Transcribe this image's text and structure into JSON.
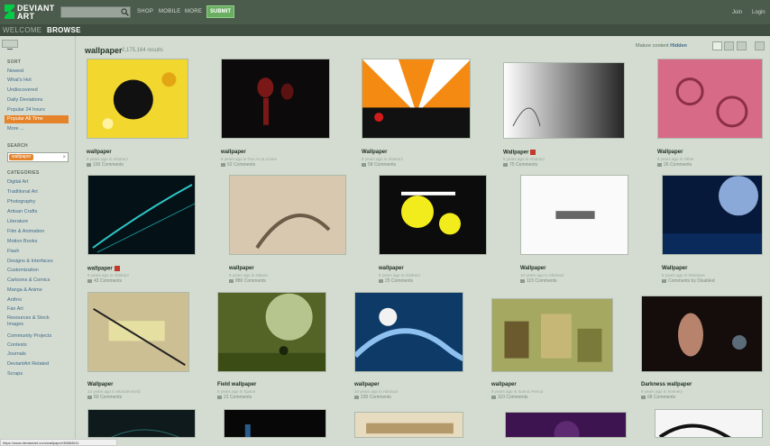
{
  "colors": {
    "topbar": "#4b5b4c",
    "accent": "#e4832a",
    "submit": "#6aae62",
    "link": "#3f6a8a"
  },
  "header": {
    "logo_line1": "DEVIANT",
    "logo_line2": "ART",
    "search_placeholder": "",
    "nav": [
      "SHOP",
      "MOBILE",
      "MORE"
    ],
    "submit": "SUBMIT",
    "join": "Join",
    "login": "Login",
    "tab_welcome": "WELCOME",
    "tab_browse": "BROWSE"
  },
  "sidebar": {
    "sort_label": "SORT",
    "sort_items": [
      "Newest",
      "What's Hot",
      "Undiscovered",
      "Daily Deviations",
      "Popular 24 hours",
      "Popular All Time",
      "More ..."
    ],
    "active_sort": "Popular All Time",
    "search_label": "SEARCH",
    "search_tag": "wallpaper",
    "categories_label": "CATEGORIES",
    "categories": [
      "Digital Art",
      "Traditional Art",
      "Photography",
      "Artisan Crafts",
      "Literature",
      "Film & Animation",
      "Motion Books",
      "Flash",
      "Designs & Interfaces",
      "Customization",
      "Cartoons & Comics",
      "Manga & Anime",
      "Anthro",
      "Fan Art",
      "Resources & Stock Images",
      "Community Projects",
      "Contests",
      "Journals",
      "DeviantArt Related",
      "Scraps"
    ]
  },
  "main": {
    "title": "wallpaper",
    "count": "2,175,164 results",
    "mature_prefix": "Mature content ",
    "mature_state": "Hidden"
  },
  "icons": {
    "search": "search-icon",
    "lock": "lock-icon",
    "comment": "comment-icon"
  },
  "items": [
    {
      "title": "wallpaper",
      "meta": "9 years ago in Abstract",
      "comments": "100 Comments"
    },
    {
      "title": "wallpaper",
      "meta": "8 years ago in Fan Art & Anime",
      "comments": "62 Comments"
    },
    {
      "title": "Wallpaper",
      "meta": "9 years ago in Abstract",
      "comments": "58 Comments"
    },
    {
      "title": "Wallpaper",
      "meta": "9 years ago in Abstract",
      "comments": "75 Comments"
    },
    {
      "title": "Wallpaper",
      "meta": "9 years ago in Other",
      "comments": "26 Comments"
    },
    {
      "title": "wallpaper",
      "meta": "9 years ago in Abstract",
      "comments": "43 Comments"
    },
    {
      "title": "wallpaper",
      "meta": "9 years ago in Nature",
      "comments": "880 Comments"
    },
    {
      "title": "wallpaper",
      "meta": "9 years ago in Abstract",
      "comments": "25 Comments"
    },
    {
      "title": "Wallpaper",
      "meta": "10 years ago in Abstract",
      "comments": "115 Comments"
    },
    {
      "title": "Wallpaper",
      "meta": "8 years ago in Windows",
      "comments": "Comments by Disabled"
    },
    {
      "title": "Wallpaper",
      "meta": "10 years ago in Wonderworld",
      "comments": "80 Comments"
    },
    {
      "title": "Field wallpaper",
      "meta": "8 years ago in Space",
      "comments": "21 Comments"
    },
    {
      "title": "wallpaper",
      "meta": "10 years ago in Abstract",
      "comments": "230 Comments"
    },
    {
      "title": "wallpaper",
      "meta": "9 years ago in Scenic Period",
      "comments": "110 Comments"
    },
    {
      "title": "Darkness wallpaper",
      "meta": "9 years ago in Scenery",
      "comments": "68 Comments"
    }
  ],
  "status_url": "https://www.deviantart.com/wallpaper/38884611"
}
